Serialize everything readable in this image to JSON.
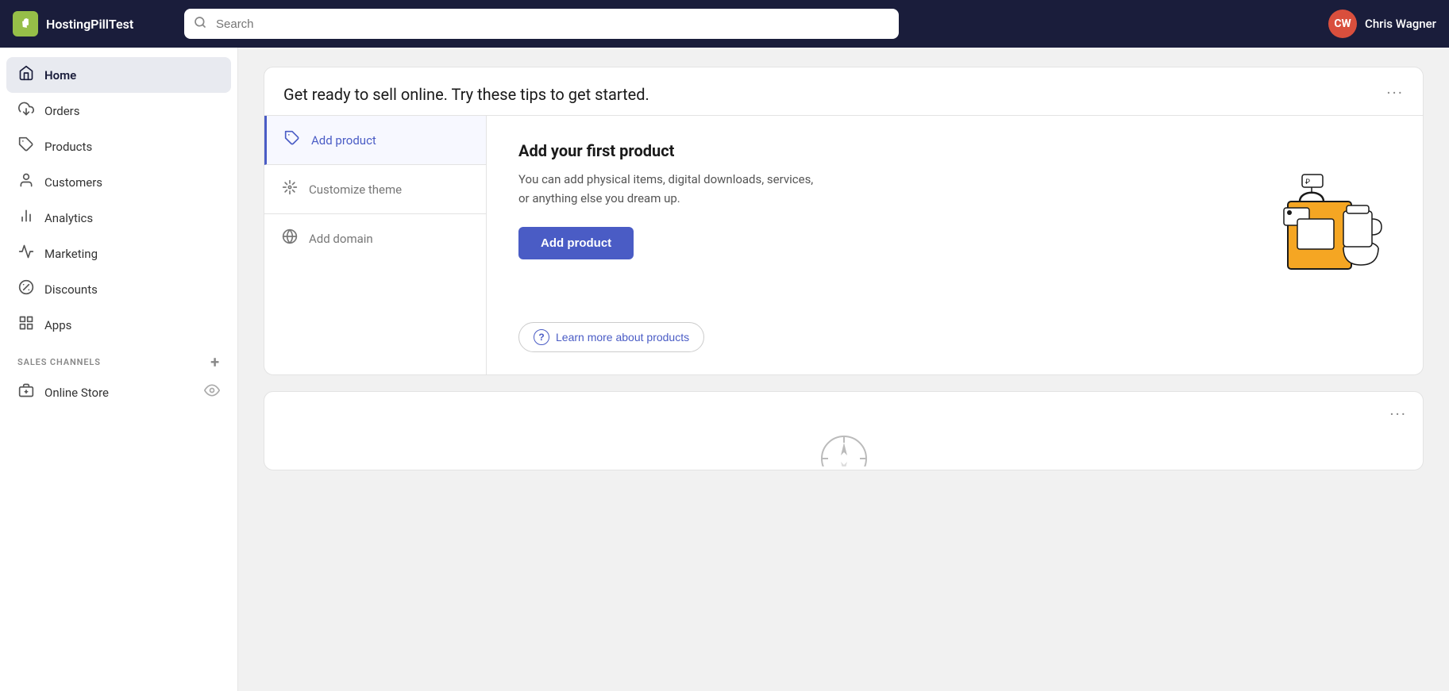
{
  "brand": {
    "name": "HostingPillTest",
    "logo_text": "S"
  },
  "search": {
    "placeholder": "Search"
  },
  "user": {
    "initials": "CW",
    "name": "Chris Wagner"
  },
  "sidebar": {
    "nav_items": [
      {
        "id": "home",
        "label": "Home",
        "icon": "🏠",
        "active": true
      },
      {
        "id": "orders",
        "label": "Orders",
        "icon": "📥",
        "active": false
      },
      {
        "id": "products",
        "label": "Products",
        "icon": "🏷️",
        "active": false
      },
      {
        "id": "customers",
        "label": "Customers",
        "icon": "👤",
        "active": false
      },
      {
        "id": "analytics",
        "label": "Analytics",
        "icon": "📊",
        "active": false
      },
      {
        "id": "marketing",
        "label": "Marketing",
        "icon": "📣",
        "active": false
      },
      {
        "id": "discounts",
        "label": "Discounts",
        "icon": "🎫",
        "active": false
      },
      {
        "id": "apps",
        "label": "Apps",
        "icon": "⊞",
        "active": false
      }
    ],
    "sales_channels_label": "SALES CHANNELS",
    "online_store_label": "Online Store"
  },
  "main_card": {
    "title": "Get ready to sell online. Try these tips to get started.",
    "three_dots": "···",
    "steps": [
      {
        "id": "add-product",
        "label": "Add product",
        "icon": "🏷",
        "active": true
      },
      {
        "id": "customize-theme",
        "label": "Customize theme",
        "icon": "✏️",
        "active": false
      },
      {
        "id": "add-domain",
        "label": "Add domain",
        "icon": "🌐",
        "active": false
      }
    ],
    "detail": {
      "title": "Add your first product",
      "description": "You can add physical items, digital downloads, services, or anything else you dream up.",
      "button_label": "Add product"
    },
    "learn_more": {
      "label": "Learn more about products",
      "icon": "?"
    }
  },
  "card2": {
    "three_dots": "···"
  }
}
